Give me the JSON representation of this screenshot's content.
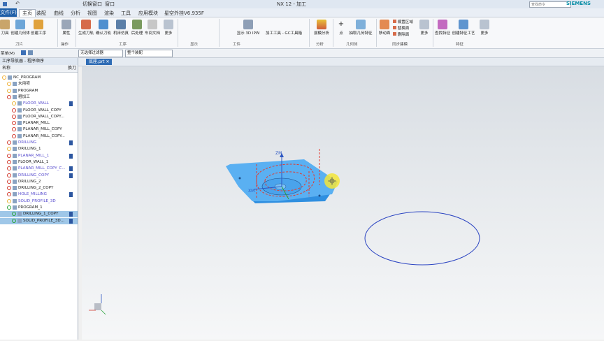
{
  "title_bar": {
    "switch_window": "切换窗口",
    "window_menu": "窗口",
    "app_title": "NX 12 - 加工",
    "brand": "SIEMENS",
    "search_placeholder": "查找命令"
  },
  "menu": {
    "file": "文件(F)",
    "tabs": [
      "主页",
      "装配",
      "曲线",
      "分析",
      "视图",
      "渲染",
      "工具",
      "应用模块",
      "星空外挂V6.935F"
    ]
  },
  "ribbon": {
    "buttons": [
      {
        "label": "刀具",
        "icon": "tool-icon"
      },
      {
        "label": "创建几何体",
        "icon": "geometry-icon"
      },
      {
        "label": "创建工序",
        "icon": "operation-icon"
      },
      {
        "label": "属性",
        "icon": "properties-icon"
      },
      {
        "label": "生成刀轨",
        "icon": "generate-path-icon"
      },
      {
        "label": "确认刀轨",
        "icon": "verify-path-icon"
      },
      {
        "label": "机床仿真",
        "icon": "machine-sim-icon"
      },
      {
        "label": "后处理",
        "icon": "postprocess-icon"
      },
      {
        "label": "车间文档",
        "icon": "shop-doc-icon"
      },
      {
        "label": "更多",
        "icon": "more-icon"
      },
      {
        "label": "显示 3D IPW",
        "icon": "ipw-icon"
      },
      {
        "label": "加工工具 - GC工具箱",
        "icon": "gc-toolbox-icon"
      },
      {
        "label": "拔模分析",
        "icon": "draft-analysis-icon"
      },
      {
        "label": "点",
        "icon": "point-icon"
      },
      {
        "label": "抽取几何特征",
        "icon": "extract-geometry-icon"
      },
      {
        "label": "移动面",
        "icon": "move-face-icon"
      },
      {
        "label": "偏置区域",
        "icon": "offset-region-icon"
      },
      {
        "label": "替换面",
        "icon": "replace-face-icon"
      },
      {
        "label": "删除面",
        "icon": "delete-face-icon"
      },
      {
        "label": "更多",
        "icon": "more-icon"
      },
      {
        "label": "查找特征",
        "icon": "find-feature-icon"
      },
      {
        "label": "创建特征工艺",
        "icon": "feature-process-icon"
      },
      {
        "label": "更多",
        "icon": "more-icon"
      }
    ],
    "groups": [
      "刀片",
      "操作",
      "工序",
      "显示",
      "工件",
      "分析",
      "几何体",
      "同步建模",
      "特征"
    ]
  },
  "toolbar": {
    "menu_label": "菜单(M)",
    "filter": "无选择过滤器",
    "assembly": "整个装配"
  },
  "navigator": {
    "title": "工序导航器 - 程序顺序",
    "col_name": "名称",
    "col_tool": "换刀",
    "rows": [
      {
        "label": "NC_PROGRAM",
        "indent": 0,
        "status": "none",
        "link": false,
        "check": false,
        "sel": false
      },
      {
        "label": "未用项",
        "indent": 1,
        "status": "none",
        "link": false,
        "check": false,
        "sel": false
      },
      {
        "label": "PROGRAM",
        "indent": 1,
        "status": "warn",
        "link": false,
        "check": false,
        "sel": false
      },
      {
        "label": "粗加工",
        "indent": 1,
        "status": "no",
        "link": false,
        "check": false,
        "sel": false
      },
      {
        "label": "FLOOR_WALL",
        "indent": 2,
        "status": "warn",
        "link": true,
        "check": true,
        "sel": false
      },
      {
        "label": "FLOOR_WALL_COPY",
        "indent": 2,
        "status": "no",
        "link": false,
        "check": false,
        "sel": false
      },
      {
        "label": "FLOOR_WALL_COPY...",
        "indent": 2,
        "status": "no",
        "link": false,
        "check": false,
        "sel": false
      },
      {
        "label": "PLANAR_MILL",
        "indent": 2,
        "status": "no",
        "link": false,
        "check": false,
        "sel": false
      },
      {
        "label": "PLANAR_MILL_COPY",
        "indent": 2,
        "status": "no",
        "link": false,
        "check": false,
        "sel": false
      },
      {
        "label": "PLANAR_MILL_COPY...",
        "indent": 2,
        "status": "no",
        "link": false,
        "check": false,
        "sel": false
      },
      {
        "label": "DRILLING",
        "indent": 1,
        "status": "no",
        "link": true,
        "check": true,
        "sel": false
      },
      {
        "label": "DRILLING_1",
        "indent": 1,
        "status": "warn",
        "link": false,
        "check": false,
        "sel": false
      },
      {
        "label": "PLANAR_MILL_1",
        "indent": 1,
        "status": "no",
        "link": true,
        "check": true,
        "sel": false
      },
      {
        "label": "FLOOR_WALL_1",
        "indent": 1,
        "status": "no",
        "link": false,
        "check": false,
        "sel": false
      },
      {
        "label": "PLANAR_MILL_COPY_C...",
        "indent": 1,
        "status": "no",
        "link": true,
        "check": true,
        "sel": false
      },
      {
        "label": "DRILLING_COPY",
        "indent": 1,
        "status": "no",
        "link": true,
        "check": true,
        "sel": false
      },
      {
        "label": "DRILLING_2",
        "indent": 1,
        "status": "no",
        "link": false,
        "check": false,
        "sel": false
      },
      {
        "label": "DRILLING_2_COPY",
        "indent": 1,
        "status": "no",
        "link": false,
        "check": false,
        "sel": false
      },
      {
        "label": "HOLE_MILLING",
        "indent": 1,
        "status": "no",
        "link": true,
        "check": true,
        "sel": false
      },
      {
        "label": "SOLID_PROFILE_3D",
        "indent": 1,
        "status": "warn",
        "link": true,
        "check": false,
        "sel": false
      },
      {
        "label": "PROGRAM_1",
        "indent": 1,
        "status": "ok",
        "link": false,
        "check": false,
        "sel": false
      },
      {
        "label": "DRILLING_1_COPY",
        "indent": 2,
        "status": "ok",
        "link": false,
        "check": true,
        "sel": true
      },
      {
        "label": "SOLID_PROFILE_3D...",
        "indent": 2,
        "status": "ok",
        "link": false,
        "check": true,
        "sel": true
      }
    ]
  },
  "viewport": {
    "tab": "底座.prt",
    "zm_label": "ZM",
    "xm_label": "XM"
  },
  "colors": {
    "part": "#3a9be8",
    "path": "#e23b2f",
    "accent": "#1f5fa8"
  }
}
